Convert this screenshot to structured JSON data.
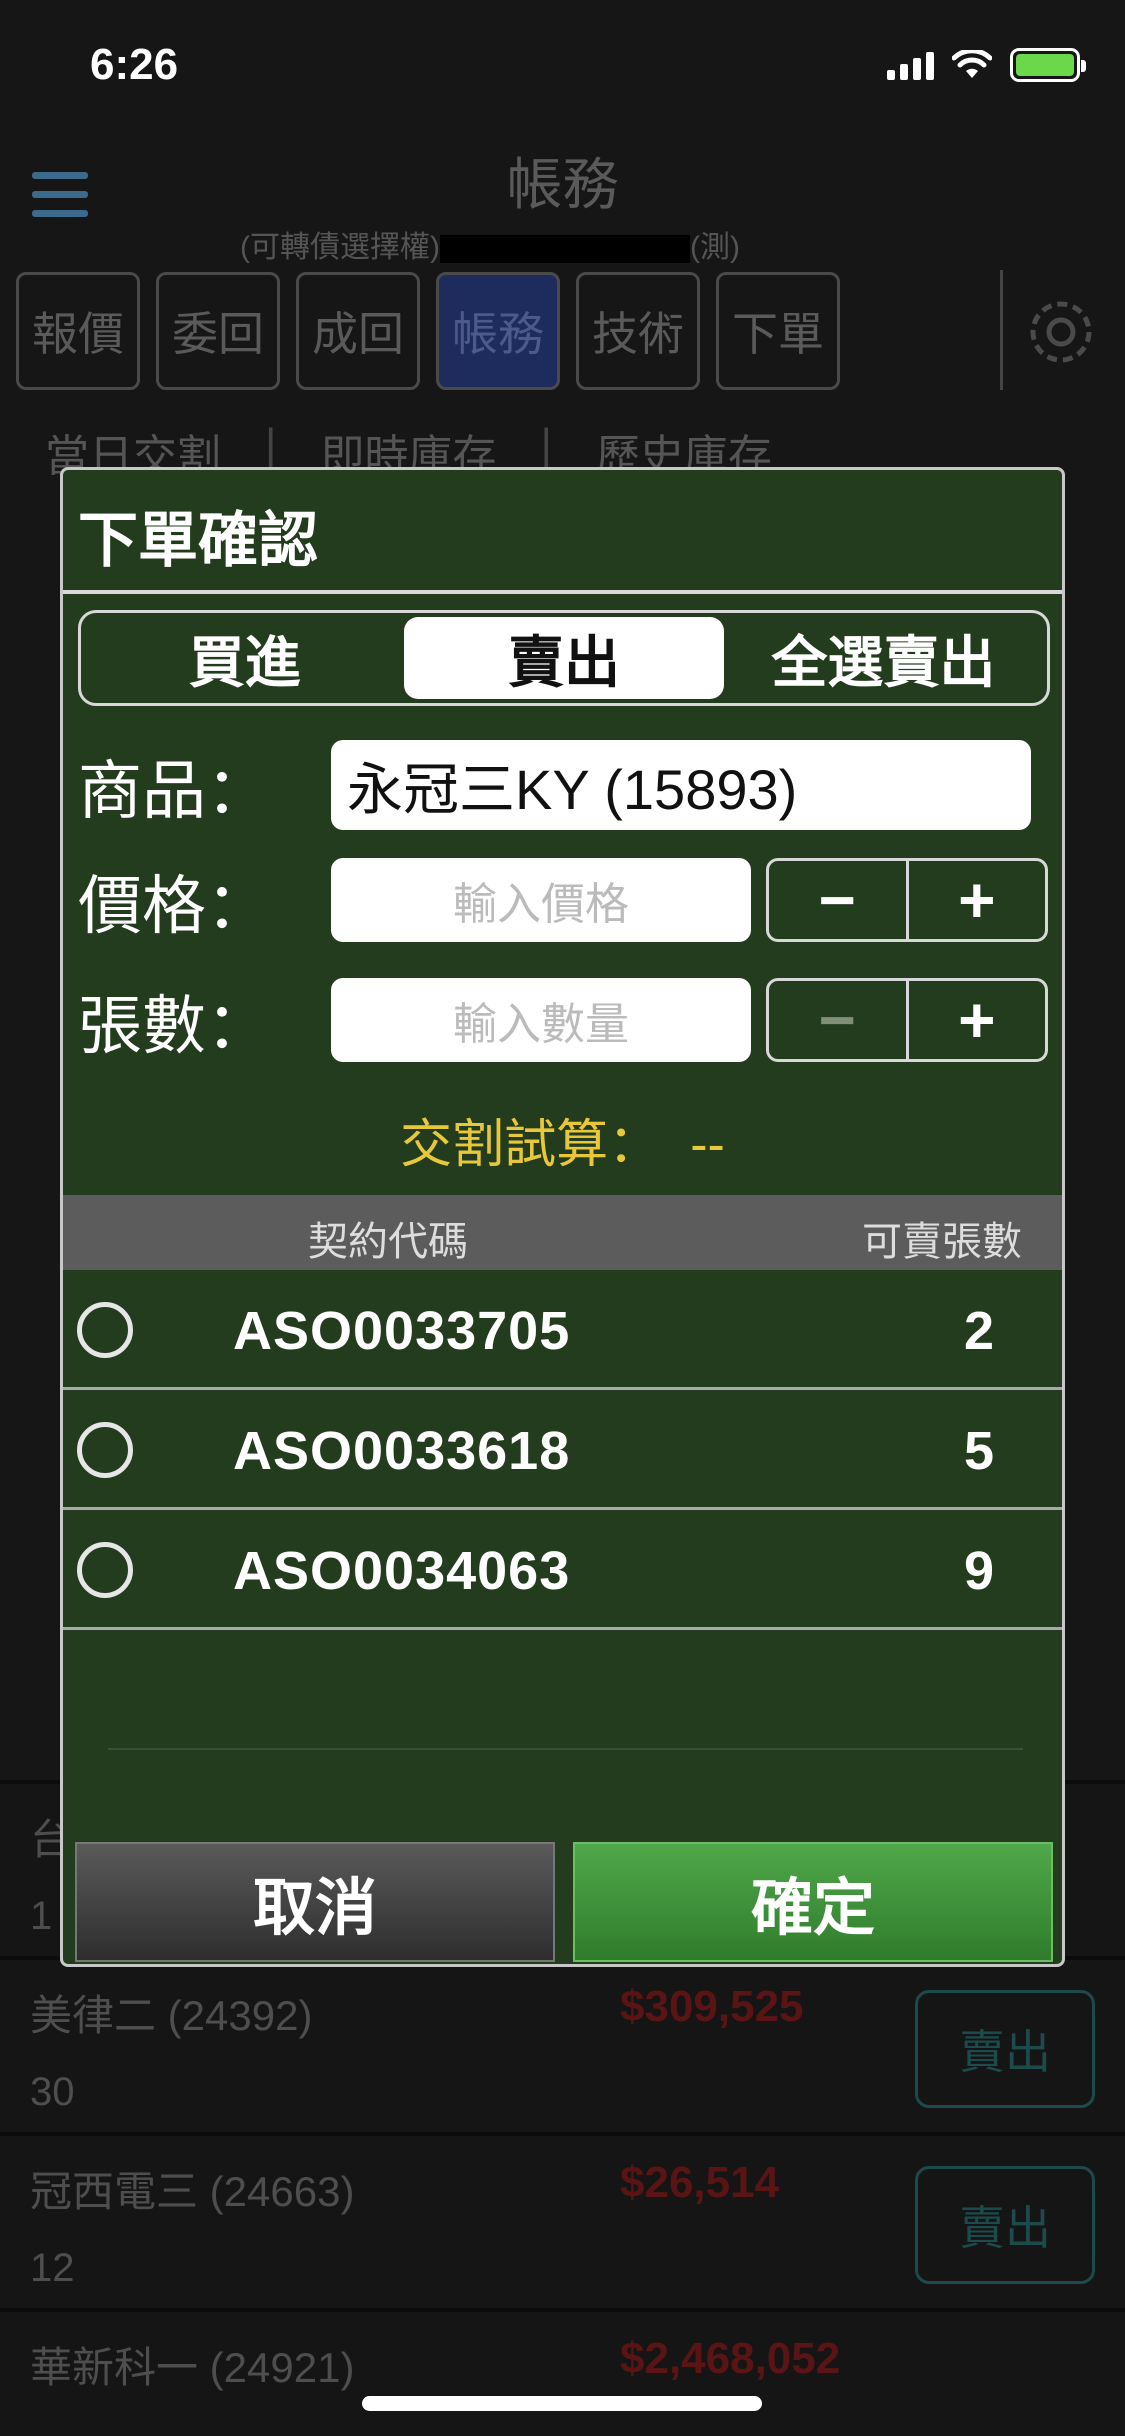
{
  "status": {
    "time": "6:26"
  },
  "header": {
    "title": "帳務",
    "subtitle_left": "(可轉債選擇權)",
    "subtitle_right": "(測)"
  },
  "top_tabs": [
    {
      "label": "報價",
      "active": false
    },
    {
      "label": "委回",
      "active": false
    },
    {
      "label": "成回",
      "active": false
    },
    {
      "label": "帳務",
      "active": true
    },
    {
      "label": "技術",
      "active": false
    },
    {
      "label": "下單",
      "active": false
    }
  ],
  "subtabs": [
    "當日交割",
    "即時庫存",
    "歷史庫存"
  ],
  "background_rows": [
    {
      "name": "台",
      "qty": "1",
      "price": "",
      "sell_label": ""
    },
    {
      "name": "美律二 (24392)",
      "qty": "30",
      "price": "$309,525",
      "sell_label": "賣出"
    },
    {
      "name": "冠西電三 (24663)",
      "qty": "12",
      "price": "$26,514",
      "sell_label": "賣出"
    },
    {
      "name": "華新科一 (24921)",
      "qty": "",
      "price": "$2,468,052",
      "sell_label": ""
    }
  ],
  "modal": {
    "title": "下單確認",
    "segments": [
      {
        "label": "買進",
        "active": false
      },
      {
        "label": "賣出",
        "active": true
      },
      {
        "label": "全選賣出",
        "active": false
      }
    ],
    "product": {
      "label": "商品：",
      "value": "永冠三KY (15893)"
    },
    "price": {
      "label": "價格：",
      "placeholder": "輸入價格",
      "minus": "−",
      "plus": "+"
    },
    "quantity": {
      "label": "張數：",
      "placeholder": "輸入數量",
      "minus": "−",
      "plus": "+"
    },
    "calc": {
      "label": "交割試算：",
      "value": "--"
    },
    "table": {
      "headers": {
        "code": "契約代碼",
        "qty": "可賣張數"
      },
      "rows": [
        {
          "code": "ASO0033705",
          "qty": "2"
        },
        {
          "code": "ASO0033618",
          "qty": "5"
        },
        {
          "code": "ASO0034063",
          "qty": "9"
        }
      ]
    },
    "buttons": {
      "cancel": "取消",
      "confirm": "確定"
    }
  },
  "colors": {
    "modal_bg": "#243c1e",
    "calc_text": "#e8c83a",
    "confirm_green": "#3f9a3a",
    "battery_green": "#6ad84a"
  }
}
